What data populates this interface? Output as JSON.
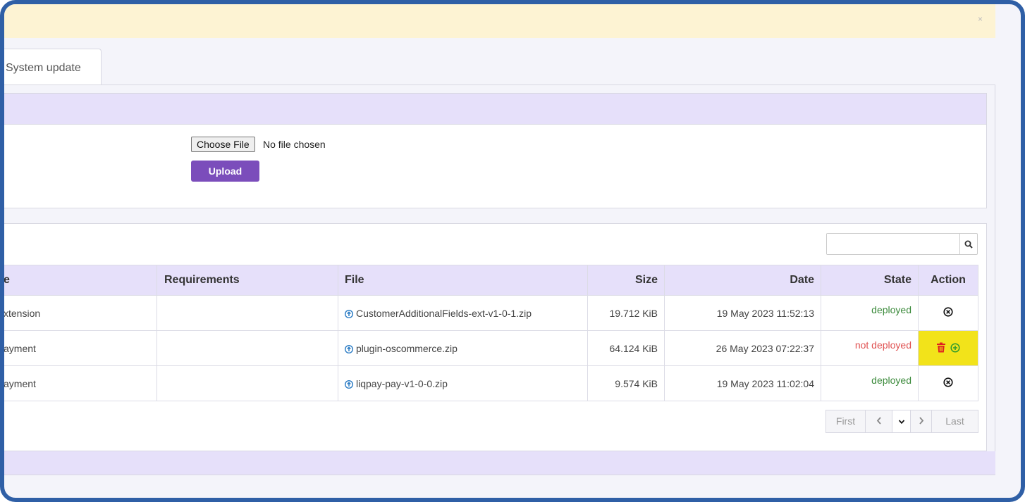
{
  "alert": {
    "close_label": "×"
  },
  "tabs": {
    "active_label": "System update"
  },
  "upload": {
    "choose_label": "Choose File",
    "no_file_text": "No file chosen",
    "upload_label": "Upload"
  },
  "search": {
    "placeholder": "",
    "icon": "search-icon"
  },
  "table": {
    "headers": {
      "name": "e",
      "requirements": "Requirements",
      "file": "File",
      "size": "Size",
      "date": "Date",
      "state": "State",
      "action": "Action"
    },
    "rows": [
      {
        "name": "xtension",
        "requirements": "",
        "file": "CustomerAdditionalFields-ext-v1-0-1.zip",
        "size": "19.712 KiB",
        "date": "19 May 2023 11:52:13",
        "state": "deployed"
      },
      {
        "name": "ayment",
        "requirements": "",
        "file": "plugin-oscommerce.zip",
        "size": "64.124 KiB",
        "date": "26 May 2023 07:22:37",
        "state": "not deployed"
      },
      {
        "name": "ayment",
        "requirements": "",
        "file": "liqpay-pay-v1-0-0.zip",
        "size": "9.574 KiB",
        "date": "19 May 2023 11:02:04",
        "state": "deployed"
      }
    ]
  },
  "pager": {
    "first": "First",
    "last": "Last"
  },
  "colors": {
    "accent": "#7b4dbb",
    "header_bg": "#e6e0fa",
    "alert_bg": "#fdf3d3",
    "deployed": "#3b8a3b",
    "not_deployed": "#e05252",
    "highlight": "#f2e31a",
    "frame": "#2f5fa6"
  }
}
